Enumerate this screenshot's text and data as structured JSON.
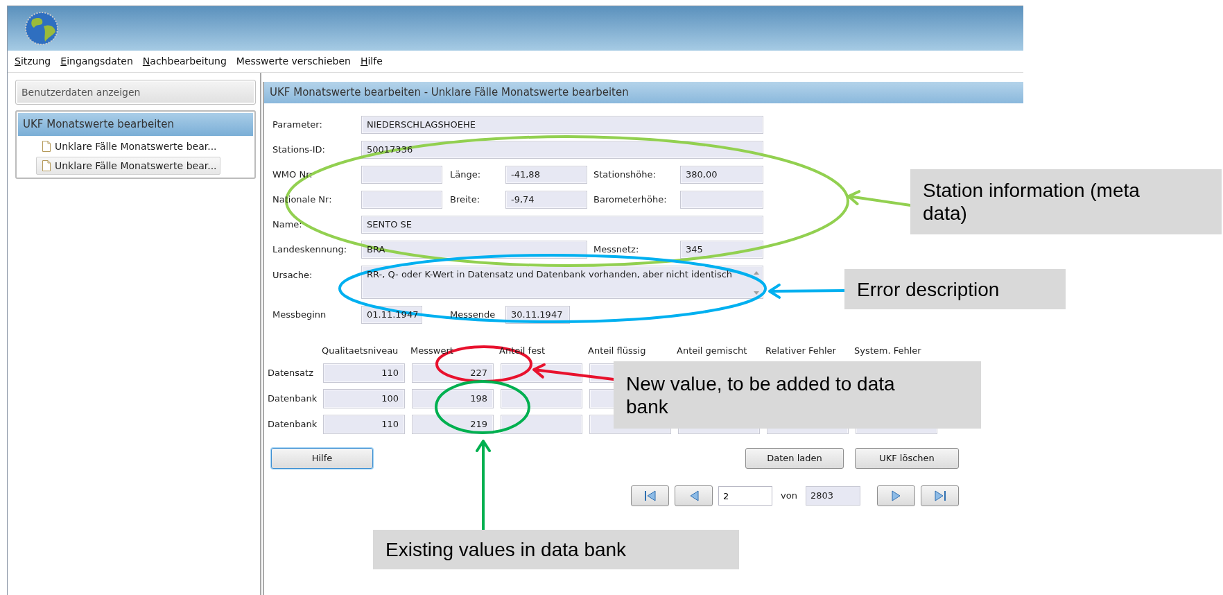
{
  "menu": [
    {
      "label": "Sitzung",
      "mnemonic": true
    },
    {
      "label": "Eingangsdaten",
      "mnemonic": true
    },
    {
      "label": "Nachbearbeitung",
      "mnemonic": true
    },
    {
      "label": "Messwerte verschieben",
      "mnemonic": false
    },
    {
      "label": "Hilfe",
      "mnemonic": true
    }
  ],
  "sidebar": {
    "button": "Benutzerdaten anzeigen",
    "tree": {
      "label": "UKF Monatswerte bearbeiten",
      "children": [
        {
          "label": "Unklare Fälle Monatswerte bear...",
          "selected": false
        },
        {
          "label": "Unklare Fälle Monatswerte bear...",
          "selected": true
        }
      ]
    }
  },
  "panel": {
    "title": "UKF Monatswerte bearbeiten - Unklare Fälle Monatswerte bearbeiten",
    "fields": [
      {
        "label": "Parameter:",
        "value": "NIEDERSCHLAGSHOEHE"
      },
      {
        "label": "Stations-ID:",
        "value": "50017336"
      },
      {
        "label": "WMO Nr:"
      },
      {
        "label": "Länge:",
        "value": "-41,88"
      },
      {
        "label": "Stationshöhe:",
        "value": "380,00"
      },
      {
        "label": "Nationale Nr:"
      },
      {
        "label": "Breite:",
        "value": "-9,74"
      },
      {
        "label": "Barometerhöhe:"
      },
      {
        "label": "Name:",
        "value": "SENTO SE"
      },
      {
        "label": "Landeskennung:",
        "value": "BRA"
      },
      {
        "label": "Messnetz:",
        "value": "345"
      },
      {
        "label": "Ursache:",
        "value": "RR-, Q- oder K-Wert in Datensatz und Datenbank vorhanden, aber nicht identisch"
      },
      {
        "label": "Messbeginn",
        "value": "01.11.1947"
      },
      {
        "label": "Messende",
        "value": "30.11.1947"
      }
    ],
    "grid": {
      "columns": [
        "Qualitaetsniveau",
        "Messwert",
        "Anteil fest",
        "Anteil flüssig",
        "Anteil gemischt",
        "Relativer Fehler",
        "System. Fehler"
      ],
      "rows": [
        {
          "label": "Datensatz",
          "cells": [
            "110",
            "227"
          ]
        },
        {
          "label": "Datenbank",
          "cells": [
            "100",
            "198"
          ]
        },
        {
          "label": "Datenbank",
          "cells": [
            "110",
            "219"
          ]
        }
      ]
    },
    "help_button": {
      "label": "Hilfe",
      "focused": true
    },
    "actions": [
      "Daten laden",
      "UKF löschen"
    ],
    "pager": {
      "page": "2",
      "of_label": "von",
      "total": "2803"
    }
  },
  "annotations": [
    {
      "text": "Station information (meta data)",
      "color": "#92d050"
    },
    {
      "text": "Error description",
      "color": "#00b0f0"
    },
    {
      "text": "New value, to be added to data bank",
      "color": "#e8112d"
    },
    {
      "text": "Existing values in data bank",
      "color": "#00b050"
    }
  ]
}
